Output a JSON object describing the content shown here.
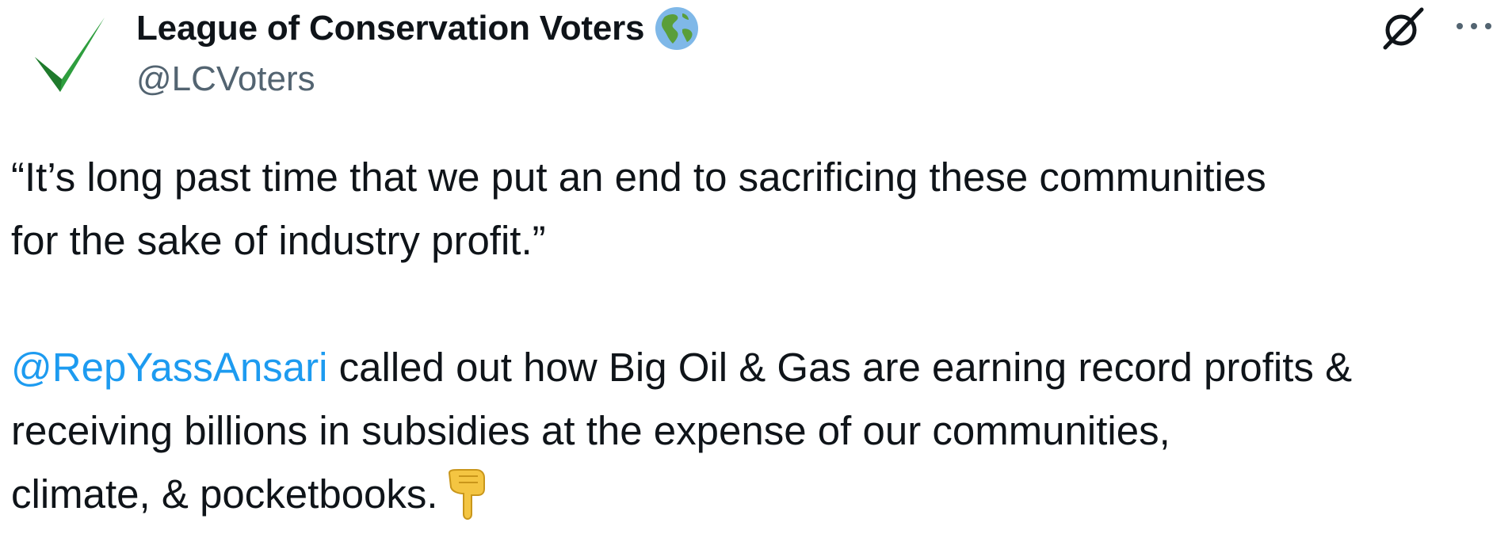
{
  "author": {
    "display_name": "League of Conservation Voters",
    "handle": "@LCVoters",
    "avatar_icon": "green-checkmark-logo",
    "name_emoji": "globe-americas-icon"
  },
  "header_actions": {
    "grok_icon": "grok-icon",
    "more_icon": "more-options-icon"
  },
  "tweet": {
    "quote_line1": "“It’s long past time that we put an end to sacrificing these communities",
    "quote_line2": "for the sake of industry profit.”",
    "mention": "@RepYassAnsari",
    "body_line1_rest": " called out how Big Oil & Gas are earning record profits &",
    "body_line2": "receiving billions in subsidies at the expense of our communities,",
    "body_line3": "climate, & pocketbooks.",
    "trailing_emoji": "backhand-index-pointing-down-icon"
  },
  "colors": {
    "text": "#0f1419",
    "secondary": "#536471",
    "link": "#1d9bf0",
    "check_green": "#2e9e3e"
  }
}
